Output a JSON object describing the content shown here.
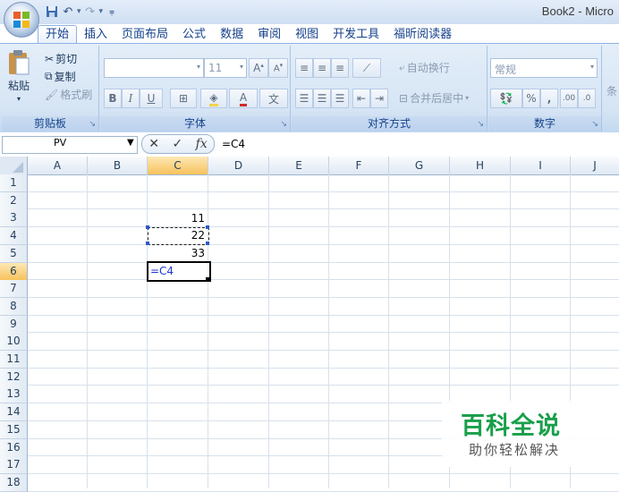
{
  "window": {
    "title": "Book2 - Micro"
  },
  "quick_access": {
    "icons": [
      "save-icon",
      "undo-icon",
      "redo-icon",
      "customize-icon"
    ]
  },
  "tabs": [
    {
      "label": "开始",
      "active": true
    },
    {
      "label": "插入"
    },
    {
      "label": "页面布局"
    },
    {
      "label": "公式"
    },
    {
      "label": "数据"
    },
    {
      "label": "审阅"
    },
    {
      "label": "视图"
    },
    {
      "label": "开发工具"
    },
    {
      "label": "福昕阅读器"
    }
  ],
  "ribbon": {
    "clipboard": {
      "paste": "粘贴",
      "cut": "剪切",
      "copy": "复制",
      "format_painter": "格式刷",
      "label": "剪贴板"
    },
    "font": {
      "font_name": "",
      "font_size": "11",
      "bold": "B",
      "italic": "I",
      "underline": "U",
      "font_color": "A",
      "label": "字体"
    },
    "alignment": {
      "wrap": "自动换行",
      "merge": "合并后居中",
      "label": "对齐方式"
    },
    "number": {
      "format": "常规",
      "percent": "%",
      "comma": ",",
      "label": "数字"
    },
    "partial": "条"
  },
  "formula_bar": {
    "name_box": "PV",
    "cancel": "✕",
    "enter": "✓",
    "fx": "fx",
    "formula": "=C4"
  },
  "columns": [
    {
      "label": "A"
    },
    {
      "label": "B"
    },
    {
      "label": "C",
      "selected": true
    },
    {
      "label": "D"
    },
    {
      "label": "E"
    },
    {
      "label": "F"
    },
    {
      "label": "G"
    },
    {
      "label": "H"
    },
    {
      "label": "I"
    },
    {
      "label": "J"
    }
  ],
  "rows": [
    "1",
    "2",
    "3",
    "4",
    "5",
    "6",
    "7",
    "8",
    "9",
    "10",
    "11",
    "12",
    "13",
    "14",
    "15",
    "16",
    "17",
    "18"
  ],
  "selected_row": "6",
  "cells": {
    "C3": "11",
    "C4": "22",
    "C5": "33",
    "C6": "=C4"
  },
  "watermark": {
    "title": "百科全说",
    "subtitle": "助你轻松解决"
  }
}
